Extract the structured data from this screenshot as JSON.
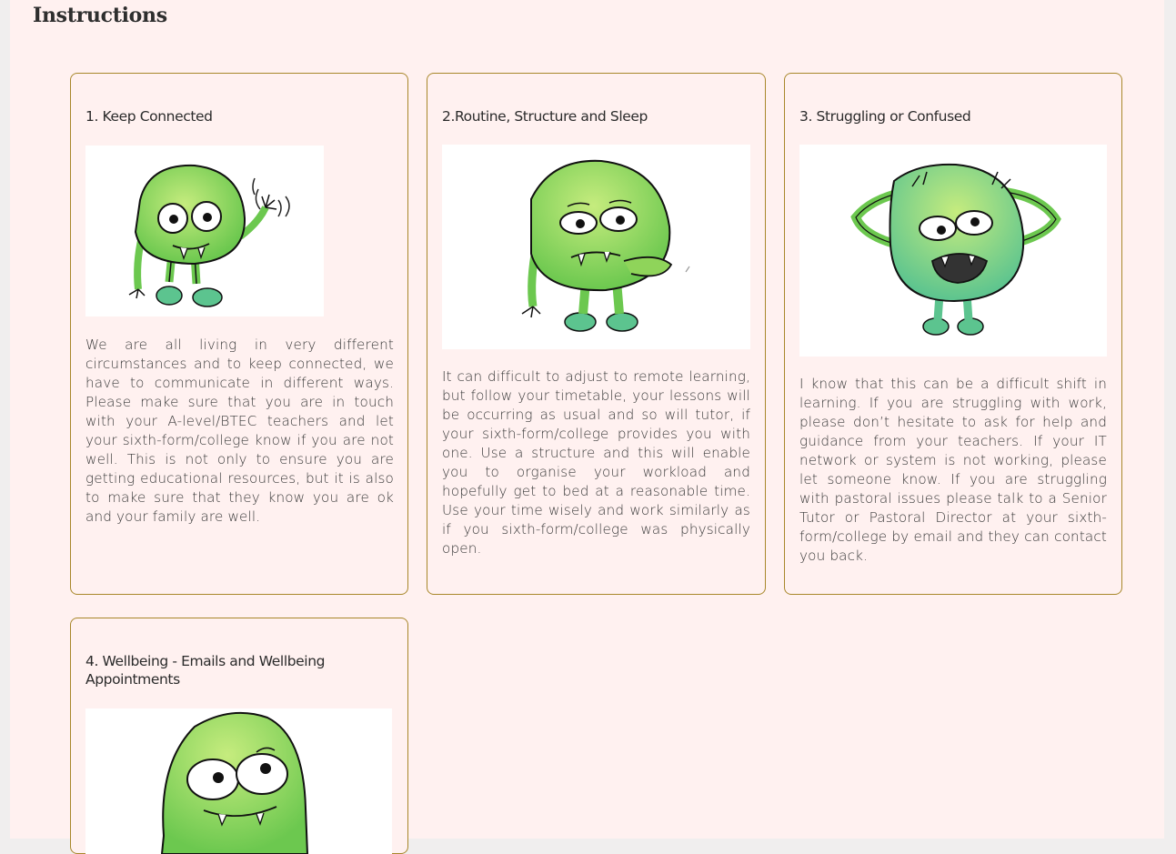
{
  "header": {
    "title": "Instructions"
  },
  "cards": [
    {
      "title": "1. Keep Connected",
      "image_icon": "waving-monster-icon",
      "text": "We are all living in very different circumstances and to keep connected, we have to communicate in different ways. Please make sure that you are in touch with your A-level/BTEC teachers and let your sixth-form/college know if you are not well. This is not only to ensure you are getting educational resources, but it is also to make sure that they know you are ok and your family are well."
    },
    {
      "title": "2.Routine, Structure and Sleep",
      "image_icon": "thinking-monster-icon",
      "text": "It can difficult to adjust to remote learning, but follow your timetable, your lessons will be occurring as usual and so will tutor, if your sixth-form/college provides you with one. Use a structure and this will enable you to organise your workload and hopefully get to bed at a reasonable time. Use your time wisely and work similarly as if you sixth-form/college was physically open."
    },
    {
      "title": "3. Struggling or Confused",
      "image_icon": "confused-monster-icon",
      "text": "I know that this can be a difficult shift in learning. If you are struggling with work, please don’t hesitate to ask for help and guidance from your teachers. If your IT network or system is not working, please let someone know. If you are struggling with pastoral issues please talk to a Senior Tutor or Pastoral Director at your sixth-form/college by email and they can contact you back."
    },
    {
      "title": "4. Wellbeing - Emails and Wellbeing Appointments",
      "image_icon": "smiling-monster-icon",
      "text": ""
    }
  ],
  "colors": {
    "page_background": "#fff1f0",
    "card_border": "#a8872a",
    "monster_green": "#8fd45a",
    "monster_teal": "#5cc48f"
  }
}
